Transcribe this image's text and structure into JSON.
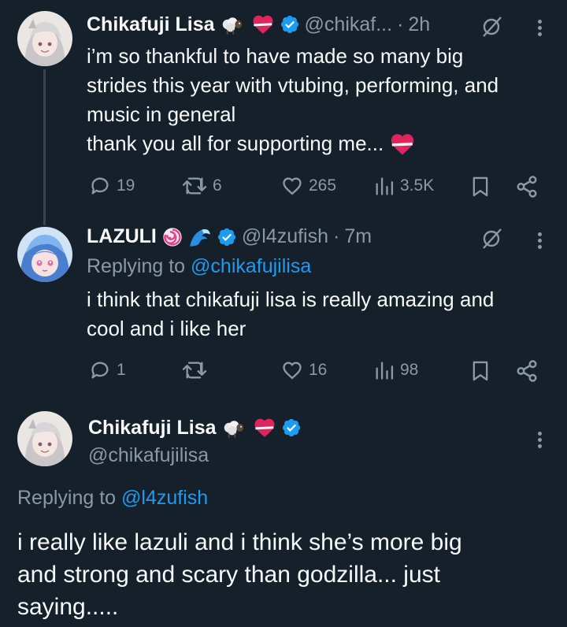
{
  "tweet1": {
    "display_name": "Chikafuji Lisa",
    "handle": "@chikaf...",
    "separator": "·",
    "time": "2h",
    "text_lines": [
      "i’m so thankful to have made so many big",
      "strides this year with vtubing, performing, and",
      "music in general",
      "thank you all for supporting me... "
    ],
    "replies": "19",
    "retweets": "6",
    "likes": "265",
    "views": "3.5K"
  },
  "tweet2": {
    "display_name": "LAZULI",
    "handle": "@l4zufish",
    "separator": "·",
    "time": "7m",
    "replying_prefix": "Replying to",
    "replying_handle": "@chikafujilisa",
    "text_lines": [
      "i think that chikafuji lisa is really amazing and",
      "cool and i like her"
    ],
    "replies": "1",
    "retweets": "",
    "likes": "16",
    "views": "98"
  },
  "tweet3": {
    "display_name": "Chikafuji Lisa",
    "handle": "@chikafujilisa",
    "replying_prefix": "Replying to",
    "replying_handle": "@l4zufish",
    "text_lines": [
      "i really like lazuli and i think she’s more big",
      "and strong and scary than godzilla... just",
      "saying....."
    ]
  },
  "colors": {
    "background": "#15202b",
    "text": "#f7f9f9",
    "muted": "#8b98a5",
    "accent": "#1d9bf0",
    "heart": "#e0245e"
  },
  "icons": [
    "reply-icon",
    "retweet-icon",
    "like-icon",
    "views-icon",
    "bookmark-icon",
    "share-icon",
    "grok-icon",
    "more-icon",
    "verified-icon",
    "sheep-emoji",
    "heart-bandage-emoji",
    "lollipop-emoji",
    "wave-emoji"
  ]
}
